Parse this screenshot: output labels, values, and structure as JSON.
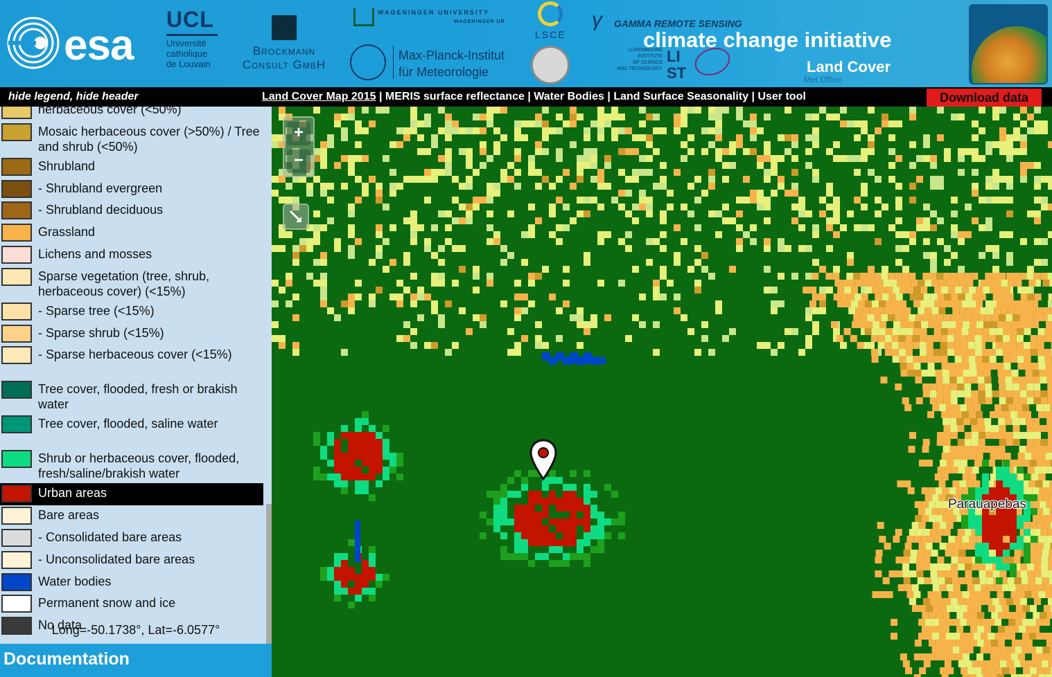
{
  "header": {
    "esa": "esa",
    "ucl": {
      "title": "UCL",
      "lines": [
        "Université",
        "catholique",
        "de Louvain"
      ]
    },
    "brockmann": {
      "lines": [
        "Brockmann",
        "Consult GmbH"
      ]
    },
    "wageningen": {
      "line1": "WAGENINGEN UNIVERSITY",
      "line2": "WAGENINGEN UR"
    },
    "mpi": {
      "lines": [
        "Max-Planck-Institut",
        "für Meteorologie"
      ]
    },
    "lsce": "LSCE",
    "gamma": "GAMMA REMOTE SENSING",
    "cci": "climate change initiative",
    "list": {
      "lines": [
        "LUXEMBOURG",
        "INSTITUTE",
        "OF SCIENCE",
        "AND TECHNOLOGY"
      ],
      "big1": "LI",
      "big2": "ST"
    },
    "land_cover": "Land Cover",
    "met_office": "Met Office"
  },
  "nav": {
    "toggle": "hide legend, hide header",
    "links": [
      "Land Cover Map 2015",
      "MERIS surface reflectance",
      "Water Bodies",
      "Land Surface Seasonality",
      "User tool"
    ],
    "separator": "|",
    "download": "Download data"
  },
  "legend": {
    "items": [
      {
        "label": "herbaceous cover (<50%)",
        "color": "#e8c96a"
      },
      {
        "label": "Mosaic herbaceous cover (>50%) / Tree and shrub (<50%)",
        "color": "#c9a130"
      },
      {
        "label": "Shrubland",
        "color": "#9c6a14"
      },
      {
        "label": "- Shrubland evergreen",
        "color": "#7a4f10"
      },
      {
        "label": "- Shrubland deciduous",
        "color": "#9e6618"
      },
      {
        "label": "Grassland",
        "color": "#f7b34a"
      },
      {
        "label": "Lichens and mosses",
        "color": "#fcdcd6"
      },
      {
        "label": "Sparse vegetation (tree, shrub, herbaceous cover) (<15%)",
        "color": "#fde8b4"
      },
      {
        "label": "- Sparse tree (<15%)",
        "color": "#fde2a8"
      },
      {
        "label": "- Sparse shrub (<15%)",
        "color": "#fdd289"
      },
      {
        "label": "- Sparse herbaceous cover (<15%)",
        "color": "#fdeab8"
      },
      {
        "label": "Tree cover, flooded, fresh or brakish water",
        "color": "#006e55"
      },
      {
        "label": "Tree cover, flooded, saline water",
        "color": "#009678"
      },
      {
        "label": "Shrub or herbaceous cover, flooded, fresh/saline/brakish water",
        "color": "#0fdc82"
      },
      {
        "label": "Urban areas",
        "color": "#c31400",
        "selected": true
      },
      {
        "label": "Bare areas",
        "color": "#fff4d7"
      },
      {
        "label": "- Consolidated bare areas",
        "color": "#dcdcdc"
      },
      {
        "label": "- Unconsolidated bare areas",
        "color": "#fff4d7"
      },
      {
        "label": "Water bodies",
        "color": "#0046c8"
      },
      {
        "label": "Permanent snow and ice",
        "color": "#ffffff"
      },
      {
        "label": "No data",
        "color": "#3a3a3a"
      }
    ],
    "coordinates": "Long=-50.1738°, Lat=-6.0577°",
    "documentation": "Documentation"
  },
  "map": {
    "zoom_in": "+",
    "zoom_out": "−",
    "place_label": "Parauapebas",
    "palette": {
      "forest": "#0b6a10",
      "cropland": "#e6f07a",
      "mosaic": "#c9e68a",
      "grass": "#f7b34a",
      "shrub": "#cf9a2a",
      "urban": "#c31400",
      "flooded": "#0fdc82",
      "green": "#1ea01e",
      "water": "#0046c8"
    }
  }
}
